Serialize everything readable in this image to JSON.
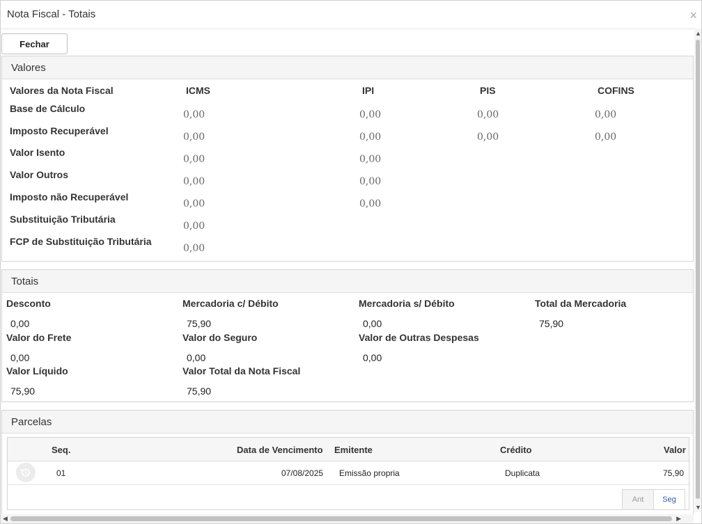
{
  "dialog": {
    "title": "Nota Fiscal - Totais",
    "close_glyph": "×",
    "fechar_label": "Fechar"
  },
  "valores": {
    "header": "Valores",
    "row_header": "Valores da Nota Fiscal",
    "columns": [
      "ICMS",
      "IPI",
      "PIS",
      "COFINS"
    ],
    "rows": [
      {
        "label": "Base de Cálculo",
        "icms": "0,00",
        "ipi": "0,00",
        "pis": "0,00",
        "cofins": "0,00"
      },
      {
        "label": "Imposto Recuperável",
        "icms": "0,00",
        "ipi": "0,00",
        "pis": "0,00",
        "cofins": "0,00"
      },
      {
        "label": "Valor Isento",
        "icms": "0,00",
        "ipi": "0,00"
      },
      {
        "label": "Valor Outros",
        "icms": "0,00",
        "ipi": "0,00"
      },
      {
        "label": "Imposto não Recuperável",
        "icms": "0,00",
        "ipi": "0,00"
      },
      {
        "label": "Substituição Tributária",
        "icms": "0,00"
      },
      {
        "label": "FCP de Substituição Tributária",
        "icms": "0,00"
      }
    ]
  },
  "totais": {
    "header": "Totais",
    "fields": [
      {
        "label": "Desconto",
        "value": "0,00"
      },
      {
        "label": "Mercadoria c/ Débito",
        "value": "75,90"
      },
      {
        "label": "Mercadoria s/ Débito",
        "value": "0,00"
      },
      {
        "label": "Total da Mercadoria",
        "value": "75,90"
      },
      {
        "label": "Valor do Frete",
        "value": "0,00"
      },
      {
        "label": "Valor do Seguro",
        "value": "0,00"
      },
      {
        "label": "Valor de Outras Despesas",
        "value": "0,00"
      },
      {
        "label": "Valor Líquido",
        "value": "75,90"
      },
      {
        "label": "Valor Total da Nota Fiscal",
        "value": "75,90"
      }
    ]
  },
  "parcelas": {
    "header": "Parcelas",
    "columns": [
      "Seq.",
      "Data de Vencimento",
      "Emitente",
      "Crédito",
      "Valor"
    ],
    "rows": [
      {
        "seq": "01",
        "data": "07/08/2025",
        "emitente": "Emissão propria",
        "credito": "Duplicata",
        "valor": "75,90",
        "icon": "history-icon"
      }
    ],
    "pager": {
      "prev": "Ant",
      "next": "Seg"
    }
  }
}
